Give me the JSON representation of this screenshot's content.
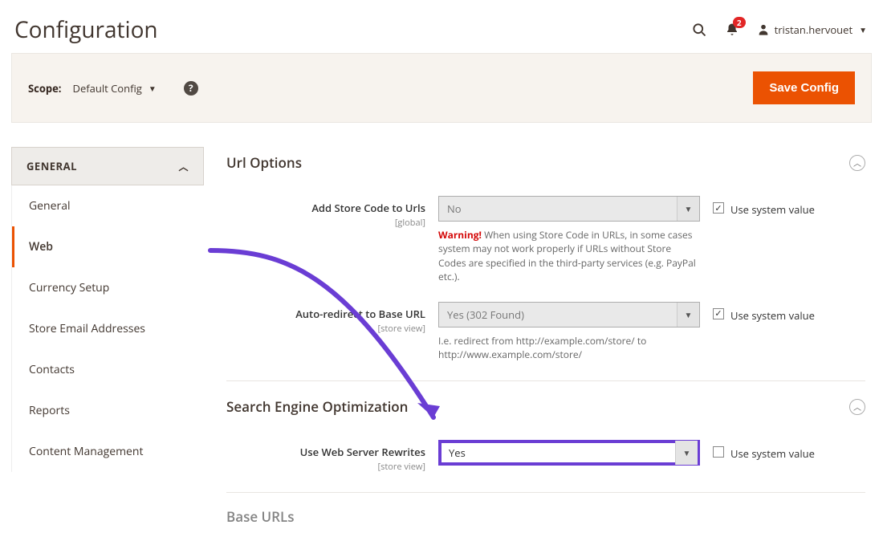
{
  "header": {
    "title": "Configuration",
    "notif_count": "2",
    "username": "tristan.hervouet"
  },
  "scope": {
    "label": "Scope:",
    "value": "Default Config",
    "save_btn": "Save Config"
  },
  "sidebar": {
    "group": "GENERAL",
    "items": [
      "General",
      "Web",
      "Currency Setup",
      "Store Email Addresses",
      "Contacts",
      "Reports",
      "Content Management"
    ],
    "active": "Web"
  },
  "sections": {
    "url": {
      "title": "Url Options",
      "f1": {
        "label": "Add Store Code to Urls",
        "scope": "[global]",
        "value": "No",
        "help_warn": "Warning!",
        "help_rest": " When using Store Code in URLs, in some cases system may not work properly if URLs without Store Codes are specified in the third-party services (e.g. PayPal etc.).",
        "sys_label": "Use system value",
        "sys_checked": true
      },
      "f2": {
        "label": "Auto-redirect to Base URL",
        "scope": "[store view]",
        "value": "Yes (302 Found)",
        "help": "I.e. redirect from http://example.com/store/ to http://www.example.com/store/",
        "sys_label": "Use system value",
        "sys_checked": true
      }
    },
    "seo": {
      "title": "Search Engine Optimization",
      "f1": {
        "label": "Use Web Server Rewrites",
        "scope": "[store view]",
        "value": "Yes",
        "sys_label": "Use system value",
        "sys_checked": false
      }
    },
    "base": {
      "title": "Base URLs"
    }
  }
}
